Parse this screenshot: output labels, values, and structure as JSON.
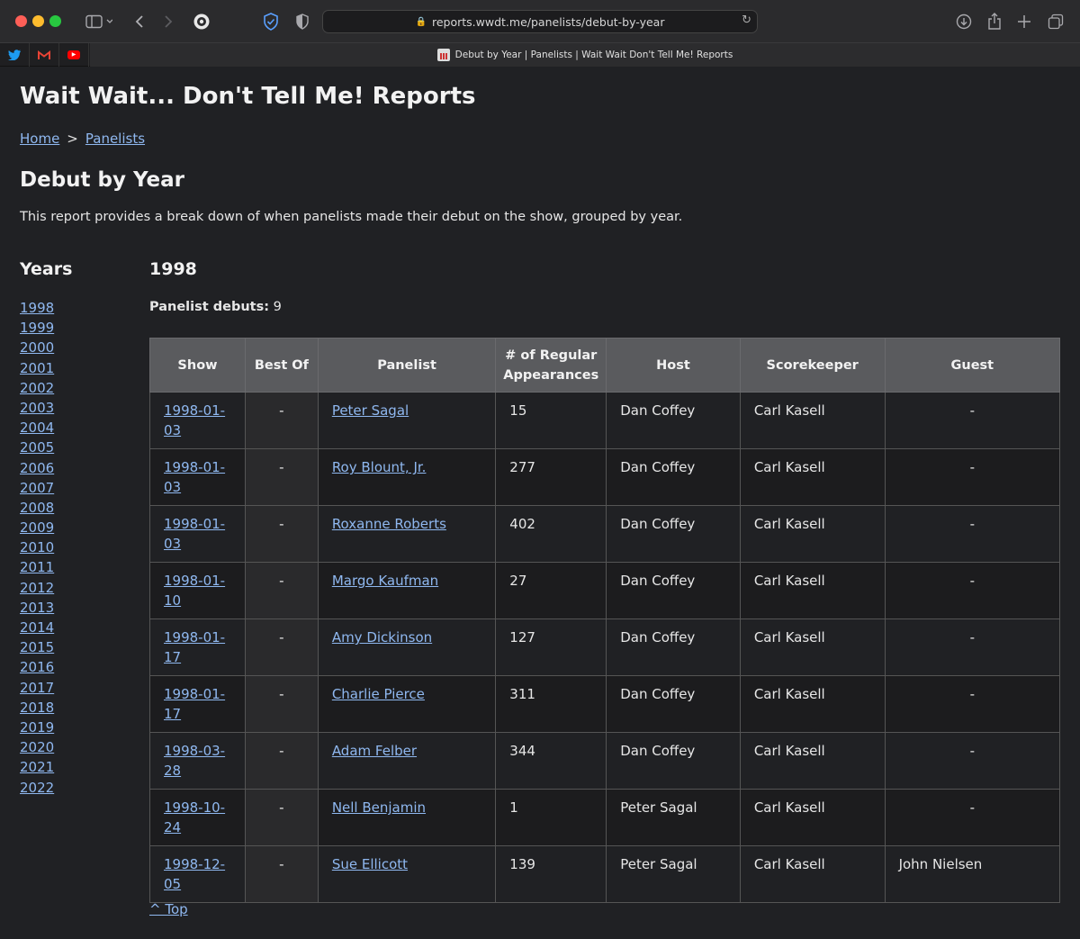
{
  "browser": {
    "url": "reports.wwdt.me/panelists/debut-by-year",
    "tab_title": "Debut by Year | Panelists | Wait Wait Don't Tell Me! Reports",
    "favorites": [
      "twitter-icon",
      "gmail-icon",
      "youtube-icon"
    ]
  },
  "site_title": "Wait Wait... Don't Tell Me! Reports",
  "breadcrumb": {
    "home": "Home",
    "sep": ">",
    "panelists": "Panelists"
  },
  "page_title": "Debut by Year",
  "intro": "This report provides a break down of when panelists made their debut on the show, grouped by year.",
  "years_heading": "Years",
  "years": [
    "1998",
    "1999",
    "2000",
    "2001",
    "2002",
    "2003",
    "2004",
    "2005",
    "2006",
    "2007",
    "2008",
    "2009",
    "2010",
    "2011",
    "2012",
    "2013",
    "2014",
    "2015",
    "2016",
    "2017",
    "2018",
    "2019",
    "2020",
    "2021",
    "2022"
  ],
  "section": {
    "year": "1998",
    "debuts_label": "Panelist debuts:",
    "debuts_count": "9"
  },
  "table": {
    "headers": [
      "Show",
      "Best Of",
      "Panelist",
      "# of Regular Appearances",
      "Host",
      "Scorekeeper",
      "Guest"
    ],
    "rows": [
      {
        "show": "1998-01-03",
        "best_of": "-",
        "panelist": "Peter Sagal",
        "appearances": "15",
        "host": "Dan Coffey",
        "scorekeeper": "Carl Kasell",
        "guest": "-"
      },
      {
        "show": "1998-01-03",
        "best_of": "-",
        "panelist": "Roy Blount, Jr.",
        "appearances": "277",
        "host": "Dan Coffey",
        "scorekeeper": "Carl Kasell",
        "guest": "-"
      },
      {
        "show": "1998-01-03",
        "best_of": "-",
        "panelist": "Roxanne Roberts",
        "appearances": "402",
        "host": "Dan Coffey",
        "scorekeeper": "Carl Kasell",
        "guest": "-"
      },
      {
        "show": "1998-01-10",
        "best_of": "-",
        "panelist": "Margo Kaufman",
        "appearances": "27",
        "host": "Dan Coffey",
        "scorekeeper": "Carl Kasell",
        "guest": "-"
      },
      {
        "show": "1998-01-17",
        "best_of": "-",
        "panelist": "Amy Dickinson",
        "appearances": "127",
        "host": "Dan Coffey",
        "scorekeeper": "Carl Kasell",
        "guest": "-"
      },
      {
        "show": "1998-01-17",
        "best_of": "-",
        "panelist": "Charlie Pierce",
        "appearances": "311",
        "host": "Dan Coffey",
        "scorekeeper": "Carl Kasell",
        "guest": "-"
      },
      {
        "show": "1998-03-28",
        "best_of": "-",
        "panelist": "Adam Felber",
        "appearances": "344",
        "host": "Dan Coffey",
        "scorekeeper": "Carl Kasell",
        "guest": "-"
      },
      {
        "show": "1998-10-24",
        "best_of": "-",
        "panelist": "Nell Benjamin",
        "appearances": "1",
        "host": "Peter Sagal",
        "scorekeeper": "Carl Kasell",
        "guest": "-"
      },
      {
        "show": "1998-12-05",
        "best_of": "-",
        "panelist": "Sue Ellicott",
        "appearances": "139",
        "host": "Peter Sagal",
        "scorekeeper": "Carl Kasell",
        "guest": "John Nielsen"
      }
    ]
  },
  "top_link": "^ Top"
}
